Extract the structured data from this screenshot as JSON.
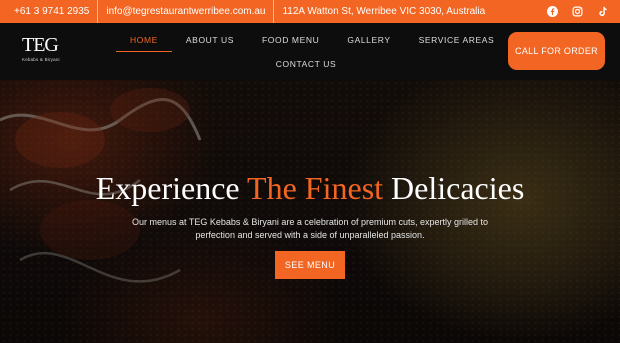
{
  "topbar": {
    "phone": "+61 3 9741 2935",
    "email": "info@tegrestaurantwerribee.com.au",
    "address": "112A Watton St, Werribee VIC 3030, Australia",
    "social_icons": [
      "facebook-icon",
      "instagram-icon",
      "tiktok-icon"
    ]
  },
  "brand": {
    "logo_mark": "TEG",
    "logo_sub": "Kebabs & Biryani"
  },
  "nav": {
    "items": [
      "HOME",
      "ABOUT US",
      "FOOD MENU",
      "GALLERY",
      "SERVICE AREAS",
      "CONTACT US"
    ],
    "active": "HOME",
    "cta_label": "CALL FOR ORDER"
  },
  "hero": {
    "headline_pre": "Experience ",
    "headline_accent": "The Finest",
    "headline_post": " Delicacies",
    "lead": "Our menus at TEG Kebabs & Biryani are a celebration of premium cuts, expertly grilled to perfection and served with a side of unparalleled passion.",
    "button_label": "SEE MENU"
  },
  "colors": {
    "accent": "#f26522",
    "header_bg": "#0d0d0d"
  }
}
